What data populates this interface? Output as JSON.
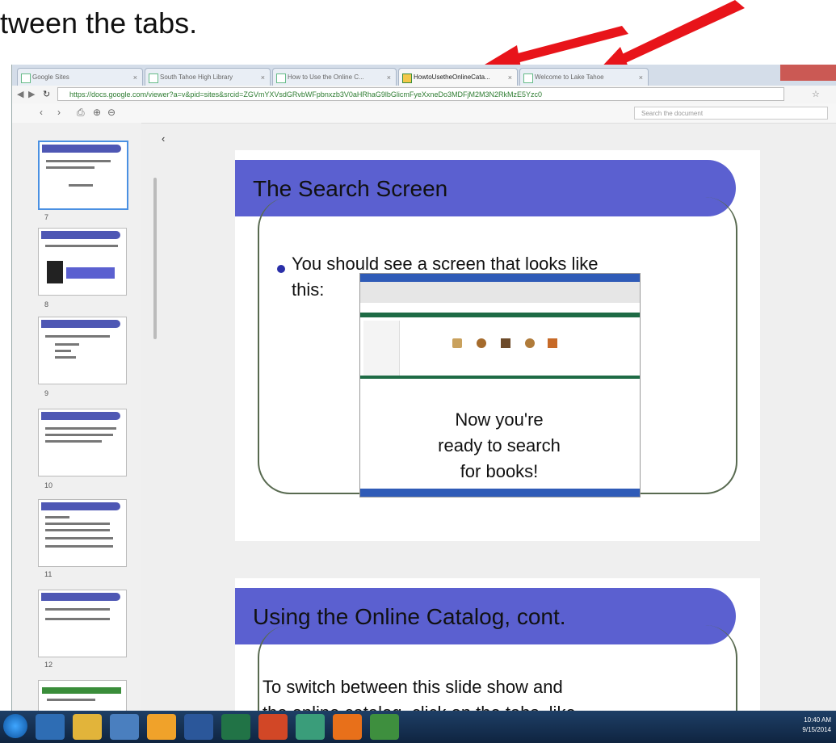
{
  "caption": {
    "text": "tween the tabs."
  },
  "browser": {
    "tabs": [
      {
        "label": "Google Sites",
        "active": false
      },
      {
        "label": "South Tahoe High Library",
        "active": false
      },
      {
        "label": "How to Use the Online C...",
        "active": false
      },
      {
        "label": "HowtoUsetheOnlineCata...",
        "active": true
      },
      {
        "label": "Welcome to Lake Tahoe",
        "active": false
      }
    ],
    "address": "https://docs.google.com/viewer?a=v&pid=sites&srcid=ZGVmYXVsdGRvbWFpbnxzb3V0aHRhaG9lbGlicmFyeXxneDo3MDFjM2M3N2RkMzE5Yzc0",
    "address_host": "https://docs.google.com",
    "search_placeholder": "Search the document"
  },
  "sidebar": {
    "thumbnails": [
      {
        "num": "",
        "title": "The Search Screen"
      },
      {
        "num": "7",
        "title": "Using the Online Catalog, cont."
      },
      {
        "num": "8",
        "title": "How to search for books"
      },
      {
        "num": "9",
        "title": "Author Search"
      },
      {
        "num": "10",
        "title": "Author Search"
      },
      {
        "num": "11",
        "title": "Author Search"
      },
      {
        "num": "12",
        "title": ""
      }
    ]
  },
  "slide1": {
    "title": "The Search Screen",
    "bullet": "You should see a screen that looks like",
    "bullet_cont": "this:",
    "ready_line1": "Now you're",
    "ready_line2": "ready to search",
    "ready_line3": "for books!"
  },
  "slide2": {
    "title": "Using the Online Catalog, cont.",
    "body_line1": "To switch between this slide show and",
    "body_line2": "the online catalog, click on the tabs, like"
  },
  "taskbar": {
    "time": "10:40 AM",
    "date": "9/15/2014"
  },
  "colors": {
    "slide_header": "#5b60d0",
    "arrow": "#e8141a",
    "taskbar": "#1e3f66"
  }
}
